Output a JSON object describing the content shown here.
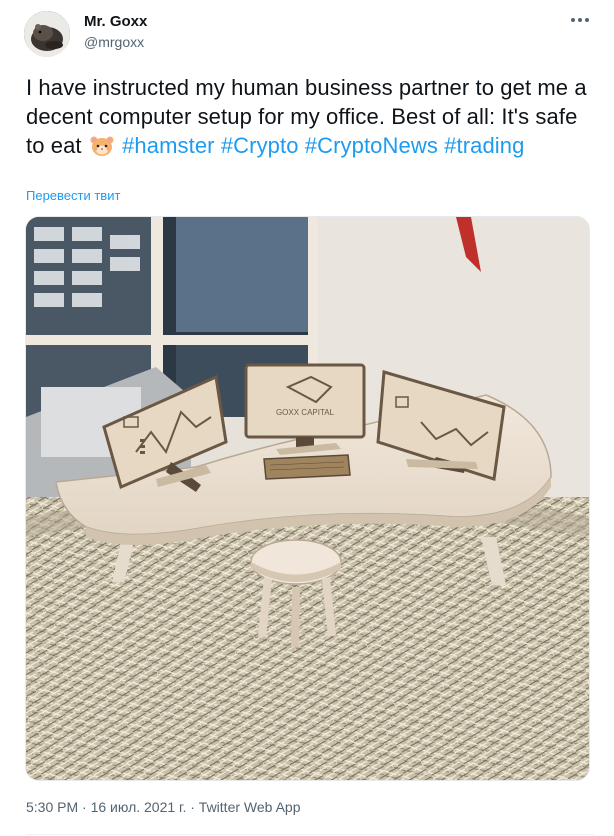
{
  "tweet": {
    "author_name": "Mr. Goxx",
    "author_handle": "@mrgoxx",
    "text_parts": {
      "p1": "I have instructed my human business partner to get me a decent computer setup for my office. Best of all: It's safe to eat",
      "h1": "#hamster",
      "h2": "#Crypto",
      "h3": "#CryptoNews",
      "h4": "#trading"
    },
    "translate_label": "Перевести твит",
    "time": "5:30 PM",
    "sep": " · ",
    "date": "16 июл. 2021 г.",
    "app": "Twitter Web App"
  },
  "media": {
    "monitor_center_label": "GOXX CAPITAL"
  },
  "colors": {
    "link": "#1d9bf0",
    "text": "#0f1419",
    "muted": "#536471"
  }
}
